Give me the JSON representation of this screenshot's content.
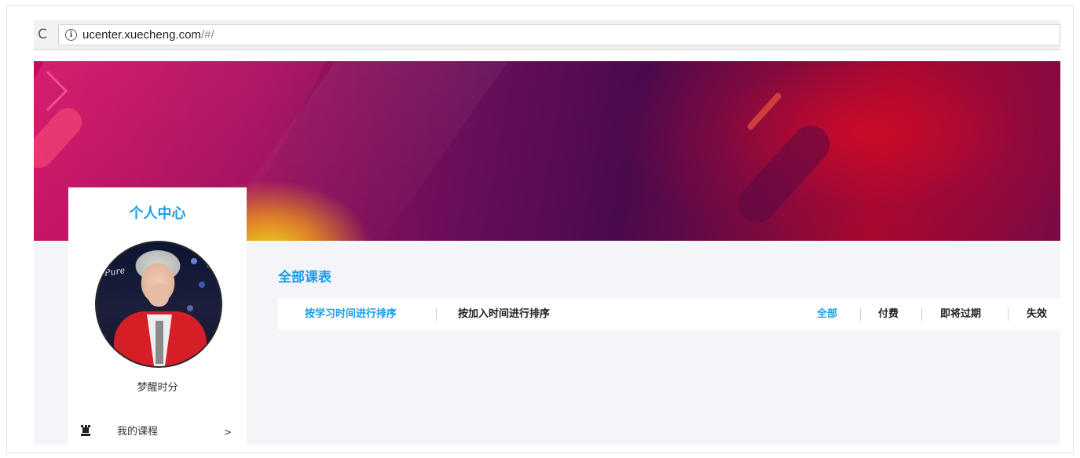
{
  "browser": {
    "reload_glyph": "C",
    "info_glyph": "i",
    "url_host": "ucenter.xuecheng.com",
    "url_path": "/#/"
  },
  "sidebar": {
    "title": "个人中心",
    "avatar_text": "Pure",
    "username": "梦醒时分",
    "menu": [
      {
        "label": "我的课程",
        "arrow": ">",
        "icon": "rook-icon"
      }
    ]
  },
  "main": {
    "section_title": "全部课表",
    "sort_tabs": [
      {
        "label": "按学习时间进行排序",
        "active": true
      },
      {
        "label": "按加入时间进行排序",
        "active": false
      }
    ],
    "filter_tabs": [
      {
        "label": "全部",
        "active": true
      },
      {
        "label": "付费",
        "active": false
      },
      {
        "label": "即将过期",
        "active": false
      },
      {
        "label": "失效",
        "active": false
      }
    ]
  },
  "colors": {
    "accent": "#1a9ce8",
    "page_bg": "#f4f5f8",
    "text": "#222222"
  }
}
